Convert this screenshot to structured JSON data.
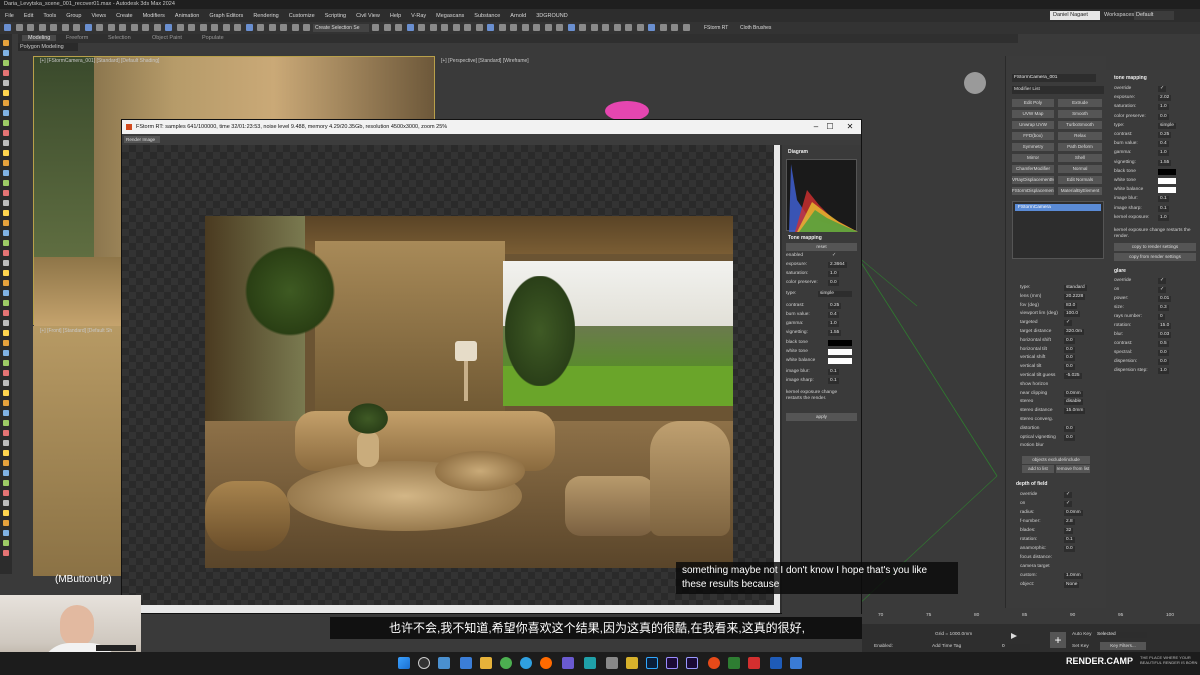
{
  "window": {
    "title": "Daria_Levytska_scene_001_recover01.max - Autodesk 3ds Max 2024",
    "user": "Daniel Nagaet",
    "workspace_label": "Workspaces:",
    "workspace_value": "Default"
  },
  "menu": [
    "File",
    "Edit",
    "Tools",
    "Group",
    "Views",
    "Create",
    "Modifiers",
    "Animation",
    "Graph Editors",
    "Rendering",
    "Customize",
    "Scripting",
    "Civil View",
    "Help",
    "V-Ray",
    "Megascans",
    "Substance",
    "Arnold",
    "3DGROUND"
  ],
  "ribbon": {
    "tabs": [
      "Modeling",
      "Freeform",
      "Selection",
      "Object Paint",
      "Populate"
    ],
    "active_tab": "Modeling",
    "sub_label": "Polygon Modeling"
  },
  "toolbar": {
    "selection_set": "Create Selection Se",
    "fstorm_rt": "FStorm RT",
    "cloth_brushes": "Cloth Brushes"
  },
  "viewports": {
    "left_top_label": "[+] [FStormCamera_001] [Standard] [Default Shading]",
    "left_bottom_label": "[+] [Front] [Standard] [Default Sh",
    "right_label": "[+] [Perspective] [Standard] [Wireframe]"
  },
  "render_window": {
    "title": "FStorm RT: samples 641/100000, time 32/01:23:53, noise level 9.488, memory 4.29/20.35Gb, resolution 4500x3000, zoom 25%",
    "mode": "Render Image",
    "min_icon": "–",
    "max_icon": "☐",
    "close_icon": "✕",
    "diagram_header": "Diagram",
    "tone_header": "Tone mapping",
    "reset": "reset",
    "apply": "apply",
    "fields": [
      {
        "label": "enabled",
        "value": "✓"
      },
      {
        "label": "exposure:",
        "value": "2.3664"
      },
      {
        "label": "saturation:",
        "value": "1.0"
      },
      {
        "label": "color preserve:",
        "value": "0.0"
      },
      {
        "label": "type:",
        "value": "simple"
      },
      {
        "label": "contrast:",
        "value": "0.25"
      },
      {
        "label": "burn value:",
        "value": "0.4"
      },
      {
        "label": "gamma:",
        "value": "1.0"
      },
      {
        "label": "vignetting:",
        "value": "1.55"
      },
      {
        "label": "black tone",
        "value": ""
      },
      {
        "label": "white tone",
        "value": ""
      },
      {
        "label": "white balance",
        "value": ""
      },
      {
        "label": "image blur:",
        "value": "0.1"
      },
      {
        "label": "image sharp:",
        "value": "0.1"
      }
    ],
    "note": "kernel exposure change restarts the render."
  },
  "command_panel": {
    "object_name": "FStormCamera_001",
    "modifier_list": "Modifier List",
    "modifiers": [
      "Edit Poly",
      "Extrude",
      "UVW Map",
      "Smooth",
      "Unwrap UVW",
      "TurboSmooth",
      "FFD(box)",
      "Relax",
      "Symmetry",
      "Path Deform",
      "Mirror",
      "Shell",
      "ChamferModifier",
      "Normal",
      "VRayDisplacementM",
      "Edit Normals",
      "FStormDisplacement",
      "MaterialByElement"
    ],
    "stack_item": "FStormCamera",
    "camera_fields": [
      {
        "label": "type:",
        "value": "standard"
      },
      {
        "label": "lens (mm)",
        "value": "20.2228"
      },
      {
        "label": "fov (deg)",
        "value": "83.0"
      },
      {
        "label": "viewport lim (deg)",
        "value": "100.0"
      },
      {
        "label": "targeted",
        "value": "✓"
      },
      {
        "label": "target distance",
        "value": "320.0m"
      },
      {
        "label": "horizontal shift",
        "value": "0.0"
      },
      {
        "label": "horizontal tilt",
        "value": "0.0"
      },
      {
        "label": "vertical shift",
        "value": "0.0"
      },
      {
        "label": "vertical tilt",
        "value": "0.0"
      },
      {
        "label": "vertical tilt guess",
        "value": "-5.025"
      },
      {
        "label": "show horizon",
        "value": ""
      },
      {
        "label": "near clipping",
        "value": "0.0mm"
      },
      {
        "label": "stereo",
        "value": "disable"
      },
      {
        "label": "stereo distance",
        "value": "15.0mm"
      },
      {
        "label": "stereo converg.",
        "value": ""
      },
      {
        "label": "distortion",
        "value": "0.0"
      },
      {
        "label": "optical vignetting",
        "value": "0.0"
      },
      {
        "label": "motion blur",
        "value": ""
      }
    ],
    "objects_btn": "objects exclude/include",
    "add_to_list": "add to list",
    "remove_from_list": "remove from list",
    "dof_header": "depth of field",
    "dof_fields": [
      {
        "label": "override",
        "value": "✓"
      },
      {
        "label": "on",
        "value": "✓"
      },
      {
        "label": "radius:",
        "value": "0.0mm"
      },
      {
        "label": "f-number:",
        "value": "2.8"
      },
      {
        "label": "blades:",
        "value": "32"
      },
      {
        "label": "rotation:",
        "value": "0.1"
      },
      {
        "label": "anamorphic:",
        "value": "0.0"
      },
      {
        "label": "focus distance:",
        "value": ""
      },
      {
        "label": "camera target",
        "value": ""
      },
      {
        "label": "custom:",
        "value": "1.0mm"
      },
      {
        "label": "object:",
        "value": "None"
      }
    ]
  },
  "tone_panel": {
    "header": "tone mapping",
    "fields": [
      {
        "label": "override",
        "value": "✓"
      },
      {
        "label": "exposure:",
        "value": "2.02"
      },
      {
        "label": "saturation:",
        "value": "1.0"
      },
      {
        "label": "color preserve:",
        "value": "0.0"
      },
      {
        "label": "type:",
        "value": "simple"
      },
      {
        "label": "contrast:",
        "value": "0.25"
      },
      {
        "label": "burn value:",
        "value": "0.4"
      },
      {
        "label": "gamma:",
        "value": "1.0"
      },
      {
        "label": "vignetting:",
        "value": "1.55"
      },
      {
        "label": "black tone",
        "value": ""
      },
      {
        "label": "white tone",
        "value": ""
      },
      {
        "label": "white balance",
        "value": ""
      },
      {
        "label": "image blur:",
        "value": "0.1"
      },
      {
        "label": "image sharp:",
        "value": "0.1"
      },
      {
        "label": "kernel exposure:",
        "value": "1.0"
      }
    ],
    "note": "kernel exposure change restarts the render.",
    "copy_to": "copy to render settings",
    "copy_from": "copy from render settings",
    "glare_header": "glare",
    "glare_fields": [
      {
        "label": "override",
        "value": "✓"
      },
      {
        "label": "on",
        "value": "✓"
      },
      {
        "label": "power:",
        "value": "0.01"
      },
      {
        "label": "size:",
        "value": "0.3"
      },
      {
        "label": "rays number:",
        "value": "0"
      },
      {
        "label": "rotation:",
        "value": "15.0"
      },
      {
        "label": "blur:",
        "value": "0.03"
      },
      {
        "label": "contrast:",
        "value": "0.5"
      },
      {
        "label": "spectral:",
        "value": "0.0"
      },
      {
        "label": "dispersion:",
        "value": "0.0"
      },
      {
        "label": "dispersion step:",
        "value": "1.0"
      }
    ]
  },
  "subtitles": {
    "en": "something maybe not I don't know I hope that's you like these results because",
    "zh": "也许不会,我不知道,希望你喜欢这个结果,因为这真的很酷,在我看来,这真的很好,"
  },
  "status": {
    "mbutton": "(MButtonUp)",
    "grid": "Grid = 1000.0mm",
    "add_time_tag": "Add Time Tag",
    "enabled": "Enabled:",
    "auto_key": "Auto Key",
    "set_key": "Set Key",
    "selected": "Selected",
    "key_filters": "Key Filters...",
    "frame": "0",
    "ticks": [
      "70",
      "75",
      "80",
      "85",
      "90",
      "95",
      "100"
    ]
  },
  "brand": {
    "name": "RENDER.CAMP",
    "tagline": "THE PLACE WHERE YOUR BEAUTIFUL RENDER IS BORN"
  },
  "colors": {
    "accent": "#d24a1e",
    "selected": "#5a8bd6",
    "panel": "#3b3b3b"
  }
}
